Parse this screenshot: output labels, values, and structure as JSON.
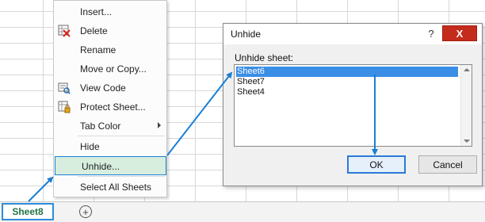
{
  "sheet_tabs": {
    "active_tab": "Sheet8",
    "add_sheet_symbol": "+"
  },
  "context_menu": {
    "items": [
      {
        "label": "Insert...",
        "icon": "none"
      },
      {
        "label": "Delete",
        "icon": "delete-sheet-icon"
      },
      {
        "label": "Rename",
        "icon": "none"
      },
      {
        "label": "Move or Copy...",
        "icon": "none"
      },
      {
        "label": "View Code",
        "icon": "view-code-icon"
      },
      {
        "label": "Protect Sheet...",
        "icon": "protect-sheet-icon"
      },
      {
        "label": "Tab Color",
        "icon": "none",
        "submenu": true
      },
      {
        "label": "Hide",
        "icon": "none"
      },
      {
        "label": "Unhide...",
        "icon": "none",
        "highlighted": true
      },
      {
        "label": "Select All Sheets",
        "icon": "none"
      }
    ]
  },
  "dialog": {
    "title": "Unhide",
    "help_symbol": "?",
    "close_symbol": "X",
    "list_label": "Unhide sheet:",
    "sheets": [
      "Sheet6",
      "Sheet7",
      "Sheet4"
    ],
    "selected_sheet": "Sheet6",
    "ok_label": "OK",
    "cancel_label": "Cancel"
  },
  "colors": {
    "accent_blue": "#1a7fd4",
    "selection_blue": "#3a8ee6",
    "highlight_green": "#d7eedf",
    "sheet_tab_text": "#1e7145",
    "close_red": "#c42b1c"
  }
}
